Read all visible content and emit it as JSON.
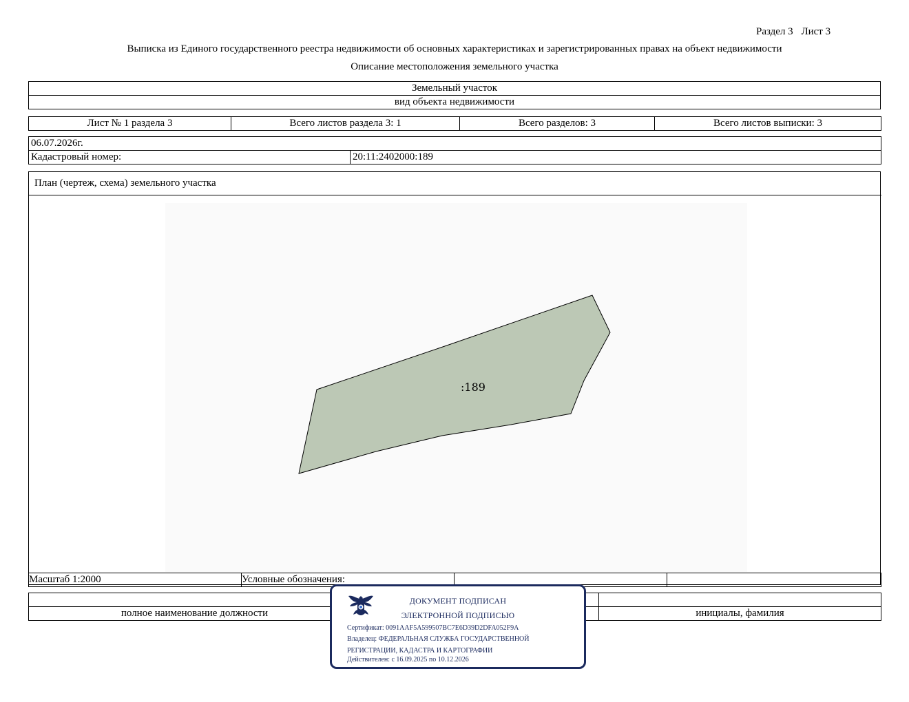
{
  "header": {
    "section": "Раздел 3",
    "sheet": "Лист 3",
    "title": "Выписка из Единого государственного реестра недвижимости об основных характеристиках и зарегистрированных правах на объект недвижимости",
    "subtitle": "Описание местоположения земельного участка"
  },
  "object": {
    "type": "Земельный участок",
    "type_caption": "вид объекта недвижимости"
  },
  "sheets": {
    "sheet_no": "Лист № 1 раздела 3",
    "total_sheets_section": "Всего листов раздела 3: 1",
    "total_sections": "Всего разделов: 3",
    "total_sheets_extract": "Всего листов выписки: 3"
  },
  "record": {
    "date": "06.07.2026г.",
    "cadastral_label": "Кадастровый номер:",
    "cadastral_number": "20:11:2402000:189"
  },
  "plan": {
    "title": "План (чертеж, схема) земельного участка",
    "parcel_label": ":189",
    "parcel_fill": "#bcc8b5"
  },
  "legend": {
    "scale": "Масштаб 1:2000",
    "symbols_label": "Условные обозначения:"
  },
  "signature": {
    "position_caption": "полное наименование должности",
    "name_caption": "инициалы, фамилия"
  },
  "stamp": {
    "line1": "ДОКУМЕНТ ПОДПИСАН",
    "line2": "ЭЛЕКТРОННОЙ ПОДПИСЬЮ",
    "certificate": "Сертификат: 0091AAF5A599507BC7E6D39D2DFA052F9A",
    "owner_line1": "Владелец: ФЕДЕРАЛЬНАЯ СЛУЖБА ГОСУДАРСТВЕННОЙ",
    "owner_line2": "РЕГИСТРАЦИИ, КАДАСТРА И КАРТОГРАФИИ",
    "valid": "Действителен: с 16.09.2025 по 10.12.2026",
    "color": "#1b2a5e"
  }
}
